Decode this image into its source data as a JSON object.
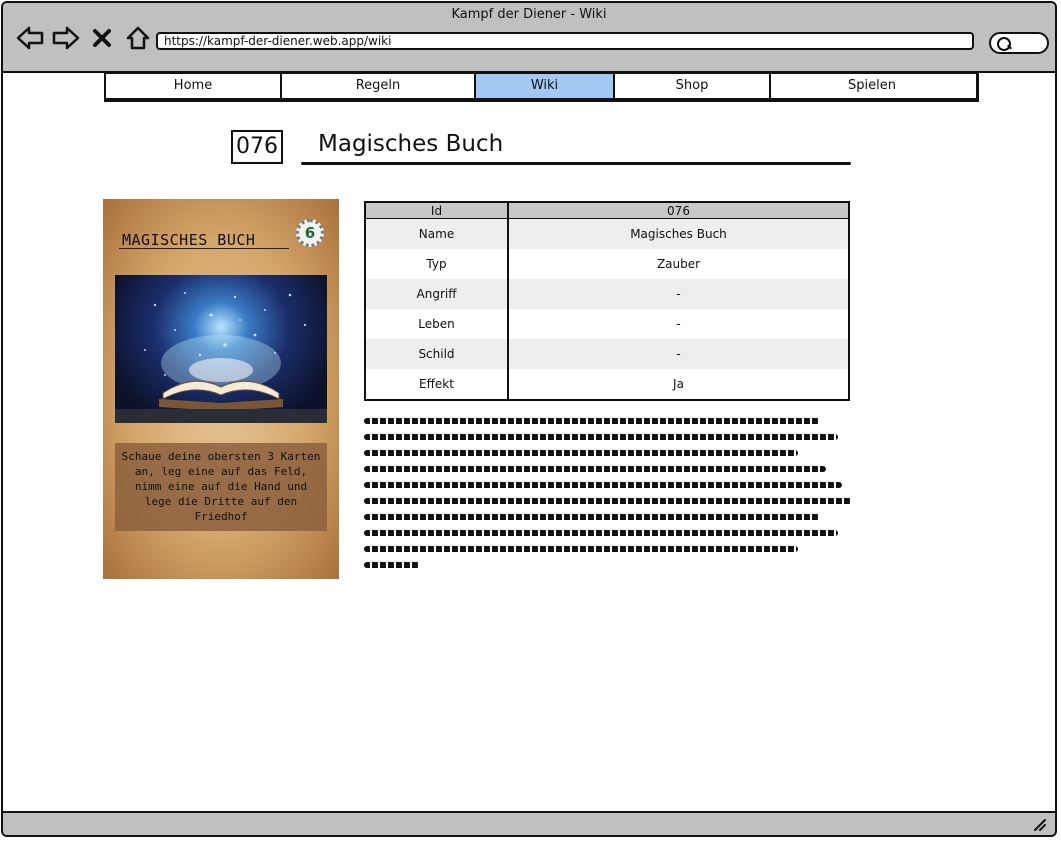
{
  "window": {
    "title": "Kampf der Diener - Wiki",
    "url": "https://kampf-der-diener.web.app/wiki"
  },
  "icons": {
    "back": "back-arrow-icon",
    "forward": "forward-arrow-icon",
    "close": "close-icon",
    "home": "home-icon",
    "search": "search-icon",
    "resize": "resize-grip-icon"
  },
  "nav": {
    "tabs": [
      {
        "label": "Home",
        "active": false
      },
      {
        "label": "Regeln",
        "active": false
      },
      {
        "label": "Wiki",
        "active": true
      },
      {
        "label": "Shop",
        "active": false
      },
      {
        "label": "Spielen",
        "active": false
      }
    ]
  },
  "page": {
    "id": "076",
    "title": "Magisches Buch"
  },
  "card": {
    "name": "MAGISCHES BUCH",
    "cost": "6",
    "text": "Schaue deine obersten 3 Karten an, leg eine auf das Feld, nimm eine auf die Hand und lege die Dritte auf den Friedhof"
  },
  "table": {
    "header": {
      "key": "Id",
      "value": "076"
    },
    "rows": [
      {
        "key": "Name",
        "value": "Magisches Buch"
      },
      {
        "key": "Typ",
        "value": "Zauber"
      },
      {
        "key": "Angriff",
        "value": "-"
      },
      {
        "key": "Leben",
        "value": "-"
      },
      {
        "key": "Schild",
        "value": "-"
      },
      {
        "key": "Effekt",
        "value": "Ja"
      }
    ]
  },
  "colors": {
    "chrome": "#c0c0c0",
    "active_tab": "#a4c8f4",
    "table_header": "#c8c8c8",
    "table_stripe": "#eeeeee"
  }
}
